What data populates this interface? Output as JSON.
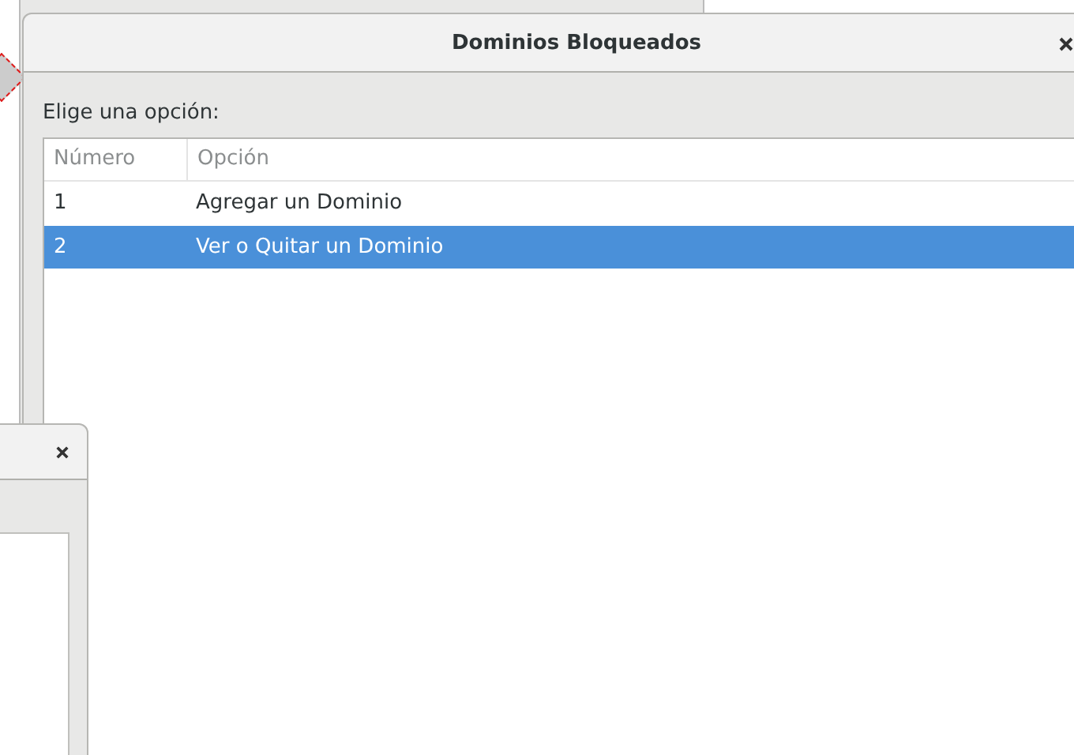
{
  "dialog": {
    "title": "Dominios Bloqueados",
    "prompt": "Elige una opción:",
    "table": {
      "columns": [
        "Número",
        "Opción"
      ],
      "rows": [
        {
          "cells": [
            "1",
            "Agregar un Dominio"
          ],
          "selected": false
        },
        {
          "cells": [
            "2",
            "Ver o Quitar un Dominio"
          ],
          "selected": true
        }
      ]
    }
  }
}
